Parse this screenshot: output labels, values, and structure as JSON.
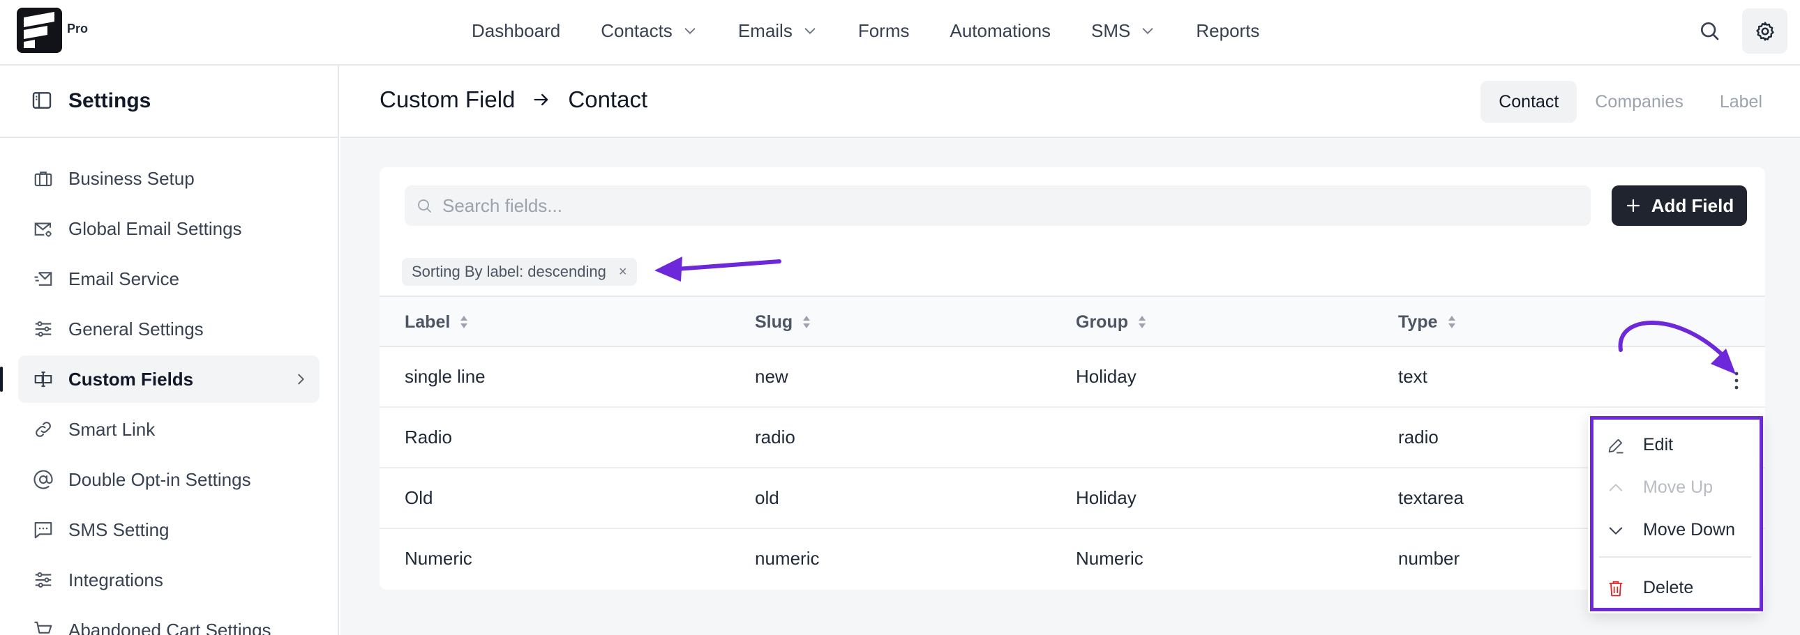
{
  "brand": {
    "badge": "Pro"
  },
  "nav": {
    "items": [
      {
        "label": "Dashboard",
        "has_dropdown": false
      },
      {
        "label": "Contacts",
        "has_dropdown": true
      },
      {
        "label": "Emails",
        "has_dropdown": true
      },
      {
        "label": "Forms",
        "has_dropdown": false
      },
      {
        "label": "Automations",
        "has_dropdown": false
      },
      {
        "label": "SMS",
        "has_dropdown": true
      },
      {
        "label": "Reports",
        "has_dropdown": false
      }
    ]
  },
  "sidebar": {
    "title": "Settings",
    "items": [
      {
        "label": "Business Setup",
        "icon": "briefcase-icon",
        "active": false
      },
      {
        "label": "Global Email Settings",
        "icon": "mail-settings-icon",
        "active": false
      },
      {
        "label": "Email Service",
        "icon": "mail-send-icon",
        "active": false
      },
      {
        "label": "General Settings",
        "icon": "sliders-icon",
        "active": false
      },
      {
        "label": "Custom Fields",
        "icon": "custom-field-icon",
        "active": true
      },
      {
        "label": "Smart Link",
        "icon": "link-icon",
        "active": false
      },
      {
        "label": "Double Opt-in Settings",
        "icon": "at-sign-icon",
        "active": false
      },
      {
        "label": "SMS Setting",
        "icon": "message-icon",
        "active": false
      },
      {
        "label": "Integrations",
        "icon": "sliders-icon",
        "active": false
      },
      {
        "label": "Abandoned Cart Settings",
        "icon": "cart-icon",
        "active": false
      }
    ]
  },
  "header": {
    "crumb_root": "Custom Field",
    "crumb_current": "Contact",
    "tabs": [
      {
        "label": "Contact",
        "active": true
      },
      {
        "label": "Companies",
        "active": false
      },
      {
        "label": "Label",
        "active": false
      }
    ]
  },
  "toolbar": {
    "search_placeholder": "Search fields...",
    "add_label": "Add Field",
    "sort_chip": "Sorting By label: descending",
    "sort_chip_close": "×"
  },
  "table": {
    "columns": [
      "Label",
      "Slug",
      "Group",
      "Type"
    ],
    "rows": [
      [
        "single line",
        "new",
        "Holiday",
        "text"
      ],
      [
        "Radio",
        "radio",
        "",
        "radio"
      ],
      [
        "Old",
        "old",
        "Holiday",
        "textarea"
      ],
      [
        "Numeric",
        "numeric",
        "Numeric",
        "number"
      ]
    ]
  },
  "row_menu": {
    "items": [
      {
        "label": "Edit",
        "icon": "edit-icon",
        "disabled": false
      },
      {
        "label": "Move Up",
        "icon": "chevron-up-icon",
        "disabled": true
      },
      {
        "label": "Move Down",
        "icon": "chevron-down-icon",
        "disabled": false
      },
      {
        "label": "Delete",
        "icon": "trash-icon",
        "disabled": false
      }
    ]
  },
  "colors": {
    "annotation": "#6d28d9",
    "delete": "#dc2626",
    "primary_button": "#1f242e"
  }
}
